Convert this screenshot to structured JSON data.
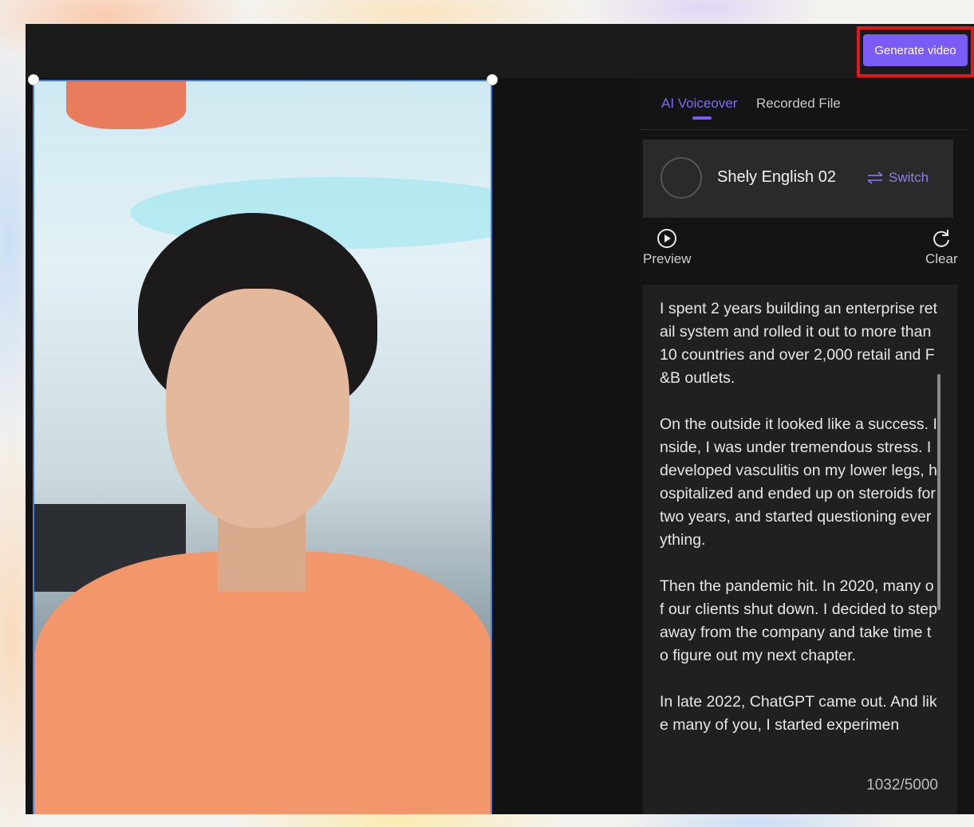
{
  "toolbar": {
    "generate_label": "Generate video"
  },
  "tabs": [
    {
      "label": "AI Voiceover",
      "active": true
    },
    {
      "label": "Recorded File",
      "active": false
    }
  ],
  "voice": {
    "name": "Shely English 02",
    "switch_label": "Switch"
  },
  "controls": {
    "preview_label": "Preview",
    "clear_label": "Clear"
  },
  "script": {
    "paragraphs": [
      "I spent 2 years building an enterprise retail system and rolled it out to more than 10 countries and over 2,000 retail and F&B outlets.",
      "On the outside it looked like a success. Inside, I was under tremendous stress. I developed vasculitis on my lower legs, hospitalized and ended up on steroids for two years, and started questioning everything.",
      "Then the pandemic hit. In 2020, many of our clients shut down. I decided to step away from the company and take time to figure out my next chapter.",
      "In late 2022, ChatGPT came out. And like many of you, I started experimen"
    ],
    "counter": "1032/5000"
  },
  "colors": {
    "accent": "#7b5cf5",
    "highlight_border": "#e3161c",
    "panel_bg": "#141414"
  }
}
